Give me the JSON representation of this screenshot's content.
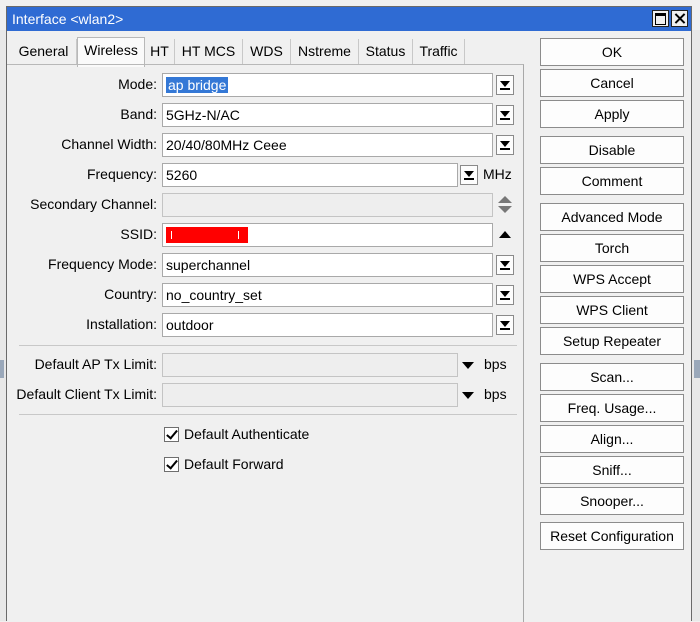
{
  "window": {
    "title": "Interface <wlan2>"
  },
  "tabs": [
    {
      "label": "General",
      "active": false
    },
    {
      "label": "Wireless",
      "active": true
    },
    {
      "label": "HT",
      "active": false
    },
    {
      "label": "HT MCS",
      "active": false
    },
    {
      "label": "WDS",
      "active": false
    },
    {
      "label": "Nstreme",
      "active": false
    },
    {
      "label": "Status",
      "active": false
    },
    {
      "label": "Traffic",
      "active": false
    }
  ],
  "fields": {
    "mode": {
      "label": "Mode:",
      "value": "ap bridge"
    },
    "band": {
      "label": "Band:",
      "value": "5GHz-N/AC"
    },
    "channel_width": {
      "label": "Channel Width:",
      "value": "20/40/80MHz Ceee"
    },
    "frequency": {
      "label": "Frequency:",
      "value": "5260",
      "unit": "MHz"
    },
    "secondary_channel": {
      "label": "Secondary Channel:",
      "value": ""
    },
    "ssid": {
      "label": "SSID:",
      "value": "[redacted]"
    },
    "frequency_mode": {
      "label": "Frequency Mode:",
      "value": "superchannel"
    },
    "country": {
      "label": "Country:",
      "value": "no_country_set"
    },
    "installation": {
      "label": "Installation:",
      "value": "outdoor"
    },
    "default_ap_tx_limit": {
      "label": "Default AP Tx Limit:",
      "value": "",
      "unit": "bps"
    },
    "default_client_tx_limit": {
      "label": "Default Client Tx Limit:",
      "value": "",
      "unit": "bps"
    }
  },
  "checkboxes": {
    "default_authenticate": {
      "label": "Default Authenticate",
      "checked": true
    },
    "default_forward": {
      "label": "Default Forward",
      "checked": true
    }
  },
  "buttons": {
    "ok": "OK",
    "cancel": "Cancel",
    "apply": "Apply",
    "disable": "Disable",
    "comment": "Comment",
    "advanced_mode": "Advanced Mode",
    "torch": "Torch",
    "wps_accept": "WPS Accept",
    "wps_client": "WPS Client",
    "setup_repeater": "Setup Repeater",
    "scan": "Scan...",
    "freq_usage": "Freq. Usage...",
    "align": "Align...",
    "sniff": "Sniff...",
    "snooper": "Snooper...",
    "reset_configuration": "Reset Configuration"
  },
  "colors": {
    "titlebar": "#2f6bd3",
    "selection": "#3478d6",
    "ssid_redaction": "#ff0000"
  }
}
